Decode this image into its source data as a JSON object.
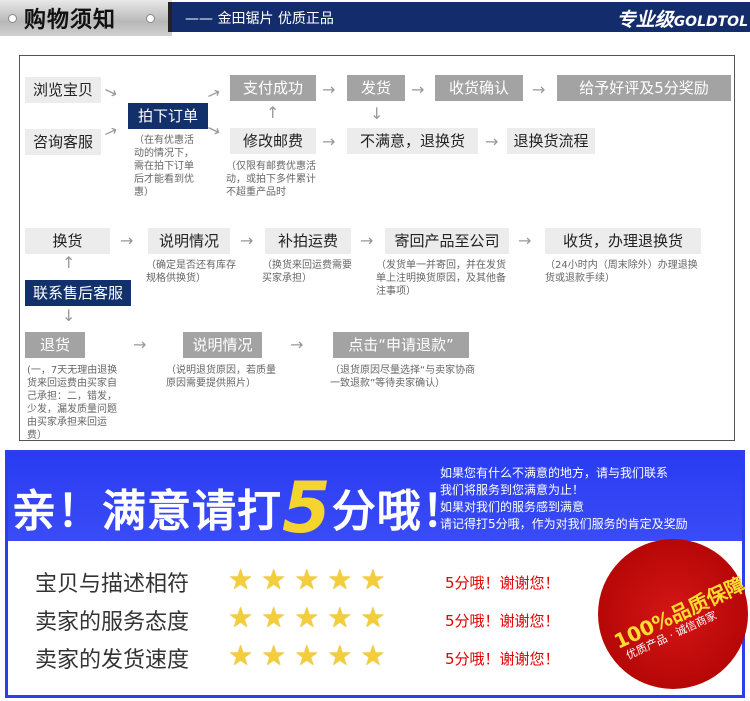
{
  "header": {
    "title": "购物须知",
    "slogan": "—— 金田锯片 优质正品",
    "brand_cn": "专业级",
    "brand_en": "GOLDTOL"
  },
  "flow": {
    "browse": "浏览宝贝",
    "consult": "咨询客服",
    "order": "拍下订单",
    "pay": "支付成功",
    "ship": "发货",
    "confirm": "收货确认",
    "review": "给予好评及5分奖励",
    "modify_postage": "修改邮费",
    "unsatisfied": "不满意，退换货",
    "return_process": "退换货流程",
    "note_order": "（在有优惠活动的情况下，需在拍下订单后才能看到优惠）",
    "note_postage": "（仅限有邮费优惠活动，或拍下多件累计不超重产品时",
    "exchange": "换货",
    "explain": "说明情况",
    "pay_shipping": "补拍运费",
    "send_back": "寄回产品至公司",
    "receive_exchange": "收货，办理退换货",
    "note_explain": "（确定是否还有库存规格供换货）",
    "note_shipping": "（换货来回运费需要买家承担）",
    "note_send_back": "（发货单一并寄回，并在发货单上注明换货原因，及其他备注事项）",
    "note_receive": "（24小时内（周末除外）办理退换货或退款手续）",
    "contact_after_sales": "联系售后客服",
    "return": "退货",
    "explain2": "说明情况",
    "click_refund": "点击“申请退款”",
    "note_return": "(一，7天无理由退换货来回运费由买家自己承担：二，错发，少发，漏发质量问题由买家承担来回运费）",
    "note_explain2": "（说明退货原因，若质量原因需要提供照片）",
    "note_refund": "（退货原因尽量选择“与卖家协商一致退款”等待卖家确认）"
  },
  "rating": {
    "headline_a": "亲！满意请打",
    "headline_five": "5",
    "headline_b": "分哦！",
    "message": [
      "如果您有什么不满意的地方，请与我们联系",
      "我们将服务到您满意为止！",
      "如果对我们的服务感到满意",
      "请记得打5分哦，作为对我们服务的肯定及奖励"
    ],
    "rows": [
      {
        "label": "宝贝与描述相符",
        "stars": 5,
        "thanks": "5分哦！谢谢您！"
      },
      {
        "label": "卖家的服务态度",
        "stars": 5,
        "thanks": "5分哦！谢谢您！"
      },
      {
        "label": "卖家的发货速度",
        "stars": 5,
        "thanks": "5分哦！谢谢您！"
      }
    ],
    "seal_main": "100%品质保障",
    "seal_sub": "优质产品 · 诚信商家",
    "colors": {
      "blue": "#2b3ff0",
      "red": "#e00000",
      "star": "#f3cd3a"
    }
  }
}
